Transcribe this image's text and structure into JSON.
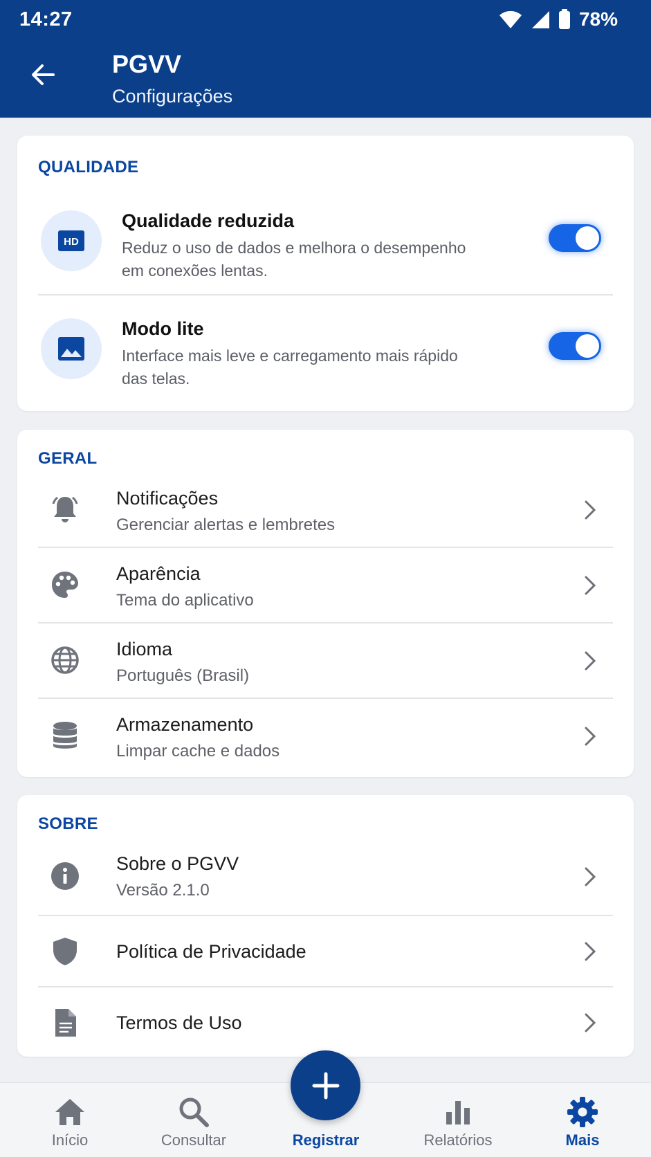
{
  "status_bar": {
    "time": "14:27",
    "battery": "78%"
  },
  "header": {
    "title": "PGVV",
    "subtitle": "Configurações"
  },
  "quality": {
    "title": "QUALIDADE",
    "items": [
      {
        "title": "Qualidade reduzida",
        "desc_line1": "Reduz o uso de dados e melhora o desempenho",
        "desc_line2": "em conexões lentas.",
        "icon": "hd-icon",
        "enabled": true
      },
      {
        "title": "Modo lite",
        "desc_line1": "Interface mais leve e carregamento mais rápido",
        "desc_line2": "das telas.",
        "icon": "image-icon",
        "enabled": true
      }
    ]
  },
  "general": {
    "title": "GERAL",
    "items": [
      {
        "title": "Notificações",
        "subtitle": "Gerenciar alertas e lembretes",
        "icon": "bell-icon"
      },
      {
        "title": "Aparência",
        "subtitle": "Tema do aplicativo",
        "icon": "palette-icon"
      },
      {
        "title": "Idioma",
        "subtitle": "Português (Brasil)",
        "icon": "globe-icon"
      },
      {
        "title": "Armazenamento",
        "subtitle": "Limpar cache e dados",
        "icon": "database-icon"
      }
    ]
  },
  "about": {
    "title": "SOBRE",
    "items": [
      {
        "title": "Sobre o PGVV",
        "subtitle": "Versão 2.1.0",
        "icon": "info-icon"
      },
      {
        "title": "Política de Privacidade",
        "icon": "shield-icon"
      },
      {
        "title": "Termos de Uso",
        "icon": "document-icon"
      }
    ]
  },
  "bottom_nav": {
    "items": [
      {
        "label": "Início",
        "icon": "home-icon"
      },
      {
        "label": "Consultar",
        "icon": "search-icon"
      },
      {
        "label": "Registrar",
        "icon": "plus-icon"
      },
      {
        "label": "Relatórios",
        "icon": "bar-chart-icon"
      },
      {
        "label": "Mais",
        "icon": "gear-icon"
      }
    ],
    "active": "Mais"
  },
  "colors": {
    "primary": "#0b3f8a",
    "accent": "#1565e6",
    "section": "#0b47a1",
    "background": "#eef0f4"
  }
}
